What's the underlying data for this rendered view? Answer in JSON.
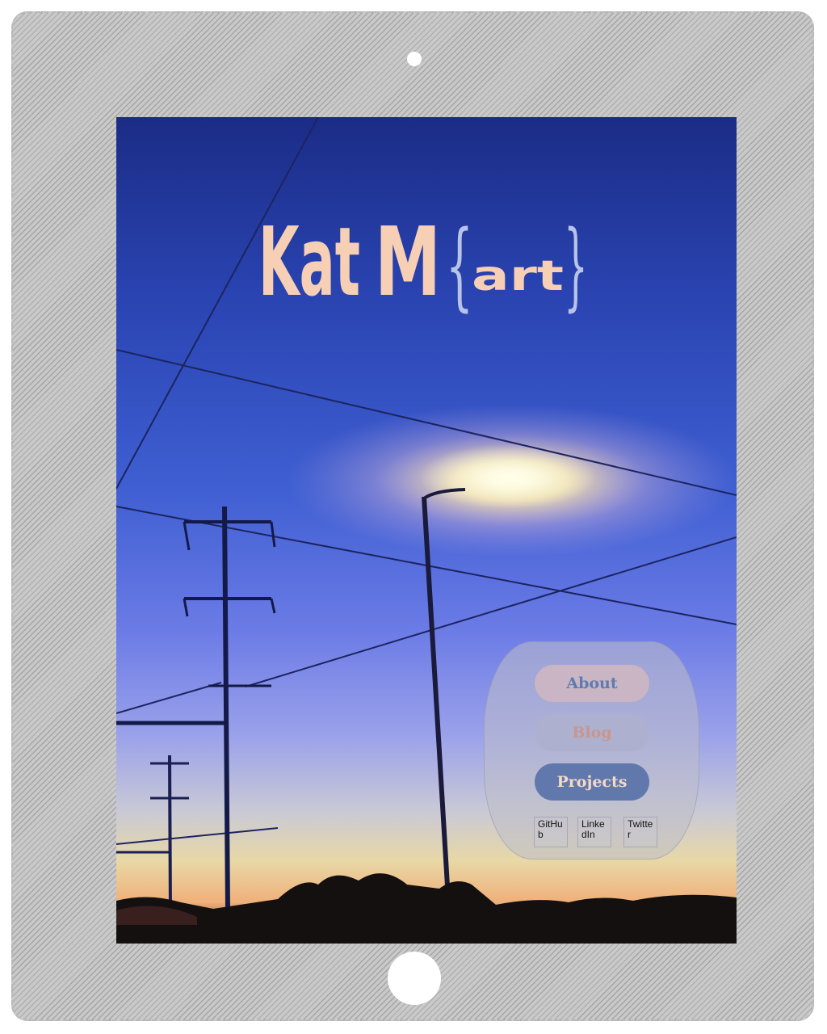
{
  "logo": {
    "part1": "Kat",
    "part2": "M",
    "brace_open": "{",
    "part3": "art",
    "brace_close": "}"
  },
  "nav": {
    "about": "About",
    "blog": "Blog",
    "projects": "Projects"
  },
  "social": {
    "github": "GitHub",
    "linkedin": "LinkedIn",
    "twitter": "Twitter"
  },
  "colors": {
    "logo_main": "#f7cfb4",
    "logo_brace": "#b8c3e8",
    "about_text": "#5f7bb0",
    "blog_text": "#c8968c",
    "projects_text": "#f2d9c6",
    "projects_bg": "#6178ad"
  }
}
